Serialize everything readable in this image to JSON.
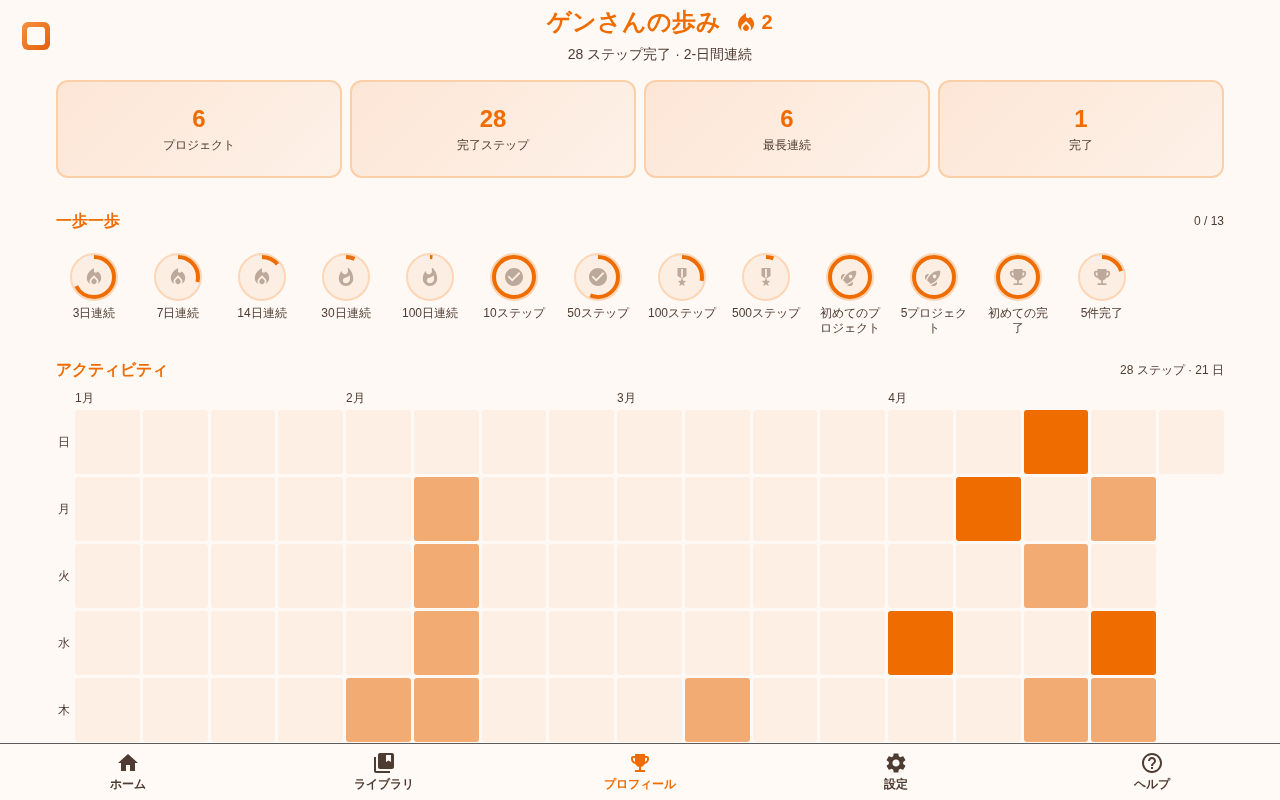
{
  "header": {
    "title": "ゲンさんの歩み",
    "streak": "2",
    "subtitle": "28 ステップ完了 · 2-日間連続"
  },
  "stats": [
    {
      "value": "6",
      "label": "プロジェクト"
    },
    {
      "value": "28",
      "label": "完了ステップ"
    },
    {
      "value": "6",
      "label": "最長連続"
    },
    {
      "value": "1",
      "label": "完了"
    }
  ],
  "badges_section": {
    "title": "一歩一歩",
    "count": "0 / 13",
    "badges": [
      {
        "label": "3日連続",
        "kind": "streak",
        "level": 0.67
      },
      {
        "label": "7日連続",
        "kind": "streak",
        "level": 0.29
      },
      {
        "label": "14日連続",
        "kind": "streak",
        "level": 0.14
      },
      {
        "label": "30日連続",
        "kind": "longstreak",
        "level": 0.07
      },
      {
        "label": "100日連続",
        "kind": "longstreak",
        "level": 0.02
      },
      {
        "label": "10ステップ",
        "kind": "check",
        "level": 1
      },
      {
        "label": "50ステップ",
        "kind": "check",
        "level": 0.56
      },
      {
        "label": "100ステップ",
        "kind": "medal",
        "level": 0.28
      },
      {
        "label": "500ステップ",
        "kind": "medal",
        "level": 0.06
      },
      {
        "label": "初めてのプロジェクト",
        "kind": "project",
        "level": 1
      },
      {
        "label": "5プロジェクト",
        "kind": "project",
        "level": 1
      },
      {
        "label": "初めての完了",
        "kind": "completion",
        "level": 1
      },
      {
        "label": "5件完了",
        "kind": "completion",
        "level": 0.2
      }
    ]
  },
  "activity": {
    "title": "アクティビティ",
    "summary": "28 ステップ · 21 日",
    "weekdays": [
      "日",
      "月",
      "火",
      "水",
      "木"
    ],
    "weeks": [
      {
        "month": "1月",
        "days": [
          {
            "color": "#fdefe4"
          },
          {
            "color": "#fdefe4"
          },
          {
            "color": "#fdefe4"
          },
          {
            "color": "#fdefe4"
          },
          {
            "color": "#fdefe4"
          }
        ]
      },
      {
        "days": [
          {
            "color": "#fdefe4"
          },
          {
            "color": "#fdefe4"
          },
          {
            "color": "#fdefe4"
          },
          {
            "color": "#fdefe4"
          },
          {
            "color": "#fdefe4"
          }
        ]
      },
      {
        "days": [
          {
            "color": "#fdefe4"
          },
          {
            "color": "#fdefe4"
          },
          {
            "color": "#fdefe4"
          },
          {
            "color": "#fdefe4"
          },
          {
            "color": "#fdefe4"
          }
        ]
      },
      {
        "days": [
          {
            "color": "#fdefe4"
          },
          {
            "color": "#fdefe4"
          },
          {
            "color": "#fdefe4"
          },
          {
            "color": "#fdefe4"
          },
          {
            "color": "#fdefe4"
          }
        ]
      },
      {
        "month": "2月",
        "days": [
          {
            "color": "#fdefe4"
          },
          {
            "color": "#fdefe4"
          },
          {
            "color": "#fdefe4"
          },
          {
            "color": "#fdefe4"
          },
          {
            "color": "#f2ab73"
          }
        ]
      },
      {
        "days": [
          {
            "color": "#fdefe4"
          },
          {
            "color": "#f2ab73"
          },
          {
            "color": "#f2ab73"
          },
          {
            "color": "#f2ab73"
          },
          {
            "color": "#f2ab73"
          }
        ]
      },
      {
        "days": [
          {
            "color": "#fdefe4"
          },
          {
            "color": "#fdefe4"
          },
          {
            "color": "#fdefe4"
          },
          {
            "color": "#fdefe4"
          },
          {
            "color": "#fdefe4"
          }
        ]
      },
      {
        "days": [
          {
            "color": "#fdefe4"
          },
          {
            "color": "#fdefe4"
          },
          {
            "color": "#fdefe4"
          },
          {
            "color": "#fdefe4"
          },
          {
            "color": "#fdefe4"
          }
        ]
      },
      {
        "month": "3月",
        "days": [
          {
            "color": "#fdefe4"
          },
          {
            "color": "#fdefe4"
          },
          {
            "color": "#fdefe4"
          },
          {
            "color": "#fdefe4"
          },
          {
            "color": "#fdefe4"
          }
        ]
      },
      {
        "days": [
          {
            "color": "#fdefe4"
          },
          {
            "color": "#fdefe4"
          },
          {
            "color": "#fdefe4"
          },
          {
            "color": "#fdefe4"
          },
          {
            "color": "#f2ab73"
          }
        ]
      },
      {
        "days": [
          {
            "color": "#fdefe4"
          },
          {
            "color": "#fdefe4"
          },
          {
            "color": "#fdefe4"
          },
          {
            "color": "#fdefe4"
          },
          {
            "color": "#fdefe4"
          }
        ]
      },
      {
        "days": [
          {
            "color": "#fdefe4"
          },
          {
            "color": "#fdefe4"
          },
          {
            "color": "#fdefe4"
          },
          {
            "color": "#fdefe4"
          },
          {
            "color": "#fdefe4"
          }
        ]
      },
      {
        "month": "4月",
        "days": [
          {
            "color": "#fdefe4"
          },
          {
            "color": "#fdefe4"
          },
          {
            "color": "#fdefe4"
          },
          {
            "color": "#ef6c00"
          },
          {
            "color": "#fdefe4"
          }
        ]
      },
      {
        "days": [
          {
            "color": "#fdefe4"
          },
          {
            "color": "#ef6c00"
          },
          {
            "color": "#fdefe4"
          },
          {
            "color": "#fdefe4"
          },
          {
            "color": "#fdefe4"
          }
        ]
      },
      {
        "days": [
          {
            "color": "#ef6c00"
          },
          {
            "color": "#fdefe4"
          },
          {
            "color": "#f2ab73"
          },
          {
            "color": "#fdefe4"
          },
          {
            "color": "#f2ab73"
          }
        ]
      },
      {
        "days": [
          {
            "color": "#fdefe4"
          },
          {
            "color": "#f2ab73"
          },
          {
            "color": "#fdefe4"
          },
          {
            "color": "#ef6c00"
          },
          {
            "color": "#f2ab73"
          }
        ]
      },
      {
        "days": [
          {
            "color": "#fdefe4"
          }
        ]
      }
    ]
  },
  "nav": [
    {
      "label": "ホーム",
      "kind": "home",
      "selected": false
    },
    {
      "label": "ライブラリ",
      "kind": "library",
      "selected": false
    },
    {
      "label": "プロフィール",
      "kind": "profile",
      "selected": true
    },
    {
      "label": "設定",
      "kind": "settings",
      "selected": false
    },
    {
      "label": "ヘルプ",
      "kind": "help",
      "selected": false
    }
  ]
}
